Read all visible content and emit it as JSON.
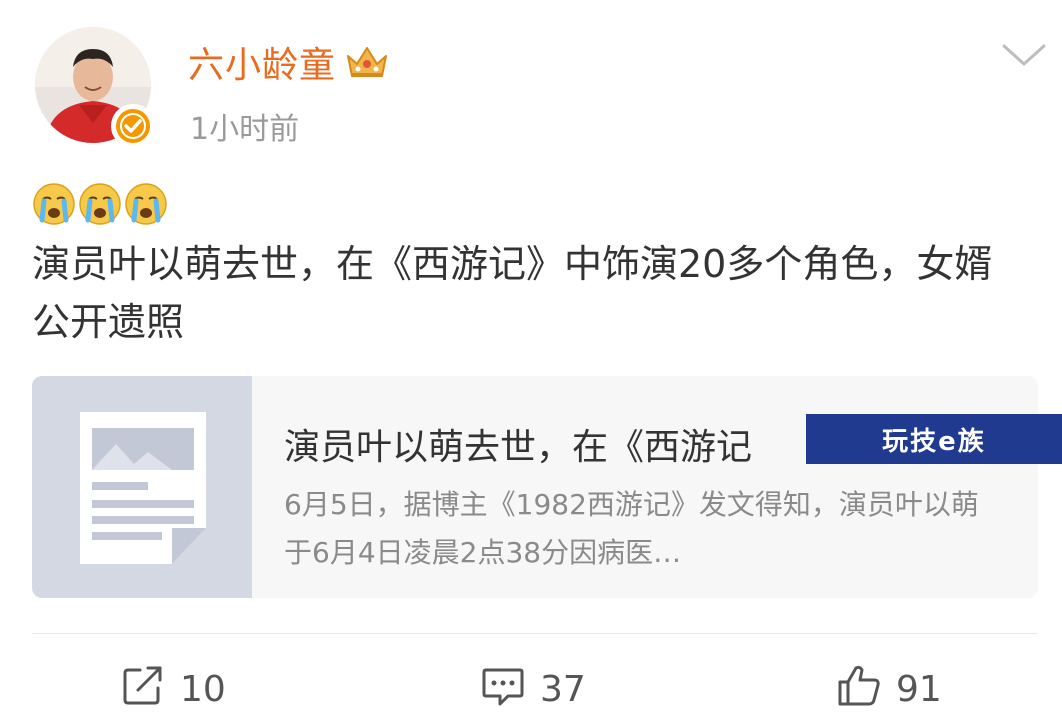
{
  "post": {
    "author": {
      "name": "六小龄童",
      "time": "1小时前"
    },
    "emojis": [
      "crying-face-emoji",
      "crying-face-emoji",
      "crying-face-emoji"
    ],
    "text": "演员叶以萌去世，在《西游记》中饰演20多个角色，女婿公开遗照"
  },
  "link_card": {
    "title": "演员叶以萌去世，在《西游记",
    "summary": "6月5日，据博主《1982西游记》发文得知，演员叶以萌于6月4日凌晨2点38分因病医…"
  },
  "watermark": {
    "text": "玩技e族"
  },
  "actions": {
    "share_count": "10",
    "comment_count": "37",
    "like_count": "91"
  },
  "colors": {
    "author_name": "#e86b1f",
    "verified_badge": "#f39800",
    "watermark_bg": "#1f3a8f",
    "card_thumb_bg": "#d4d8e3"
  }
}
